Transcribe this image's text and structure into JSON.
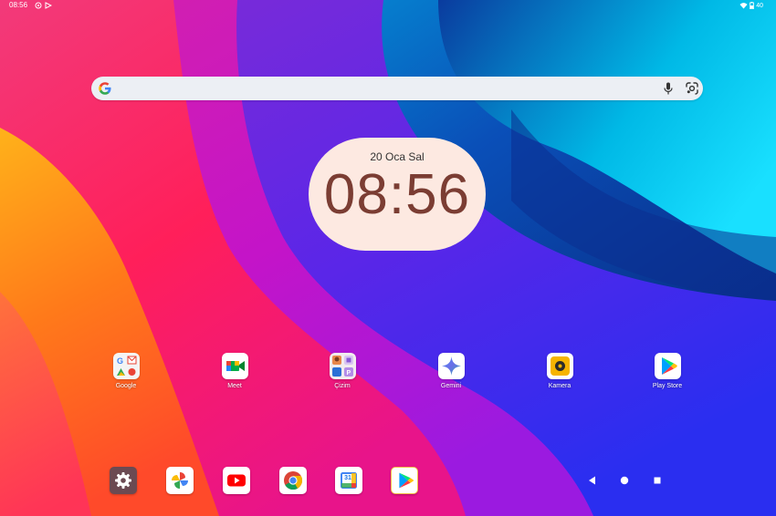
{
  "status_bar": {
    "time": "08:56",
    "battery": "40"
  },
  "search": {
    "placeholder": ""
  },
  "clock": {
    "date": "20 Oca Sal",
    "time": "08:56"
  },
  "apps": [
    {
      "label": "Google"
    },
    {
      "label": "Meet"
    },
    {
      "label": "Çizim"
    },
    {
      "label": "Gemini"
    },
    {
      "label": "Kamera"
    },
    {
      "label": "Play Store"
    }
  ],
  "dock": [
    {
      "icon": "settings-icon"
    },
    {
      "icon": "photos-icon"
    },
    {
      "icon": "youtube-icon"
    },
    {
      "icon": "chrome-icon"
    },
    {
      "icon": "calendar-icon",
      "day": "31"
    },
    {
      "icon": "play-games-icon"
    }
  ],
  "navigation": [
    "back-icon",
    "home-icon",
    "recents-icon"
  ],
  "colors": {
    "clock_bg": "#fde9e1",
    "clock_text": "#7b3d33",
    "search_bg": "#eceff4"
  }
}
